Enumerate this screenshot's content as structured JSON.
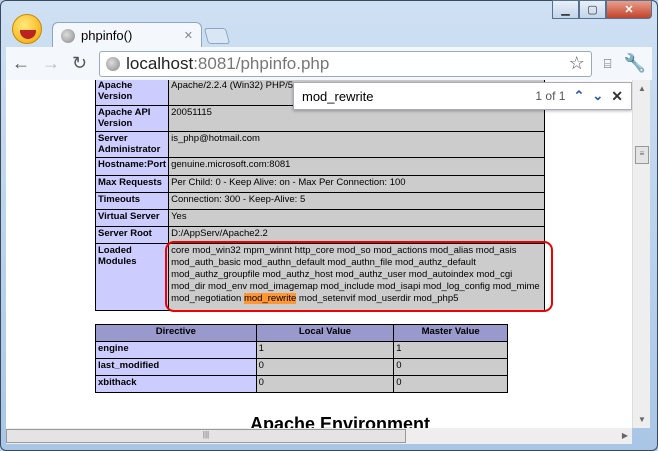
{
  "browser": {
    "tab_title": "phpinfo()",
    "url_host": "localhost",
    "url_rest": ":8081/phpinfo.php"
  },
  "find": {
    "query": "mod_rewrite",
    "count": "1 of 1"
  },
  "config_table": [
    {
      "key": "Apache Version",
      "value": "Apache/2.2.4 (Win32) PHP/5"
    },
    {
      "key": "Apache API Version",
      "value": "20051115"
    },
    {
      "key": "Server Administrator",
      "value": "is_php@hotmail.com"
    },
    {
      "key": "Hostname:Port",
      "value": "genuine.microsoft.com:8081"
    },
    {
      "key": "Max Requests",
      "value": "Per Child: 0 - Keep Alive: on - Max Per Connection: 100"
    },
    {
      "key": "Timeouts",
      "value": "Connection: 300 - Keep-Alive: 5"
    },
    {
      "key": "Virtual Server",
      "value": "Yes"
    },
    {
      "key": "Server Root",
      "value": "D:/AppServ/Apache2.2"
    }
  ],
  "modules": {
    "key": "Loaded Modules",
    "before": "core mod_win32 mpm_winnt http_core mod_so mod_actions mod_alias mod_asis mod_auth_basic mod_authn_default mod_authn_file mod_authz_default mod_authz_groupfile mod_authz_host mod_authz_user mod_autoindex mod_cgi mod_dir mod_env mod_imagemap mod_include mod_isapi mod_log_config mod_mime mod_negotiation ",
    "match": "mod_rewrite",
    "after": " mod_setenvif mod_userdir mod_php5"
  },
  "directive_table": {
    "headers": [
      "Directive",
      "Local Value",
      "Master Value"
    ],
    "rows": [
      [
        "engine",
        "1",
        "1"
      ],
      [
        "last_modified",
        "0",
        "0"
      ],
      [
        "xbithack",
        "0",
        "0"
      ]
    ]
  },
  "next_heading": "Apache Environment"
}
